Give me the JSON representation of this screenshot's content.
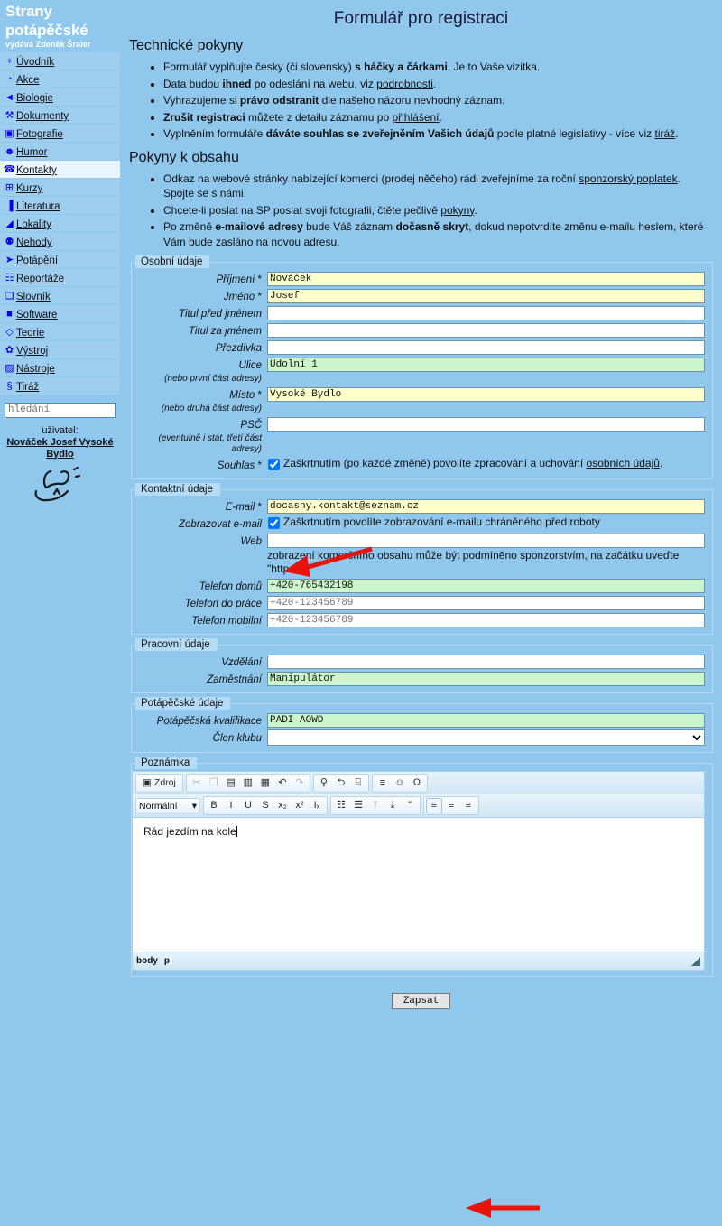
{
  "colors": {
    "page_bg": "#8fc7ed",
    "nav_bg": "#9dcdef",
    "nav_active_bg": "#e9f4fc",
    "legend_bg": "#b5dbf5",
    "required_field_bg": "#ffffcc",
    "filled_field_bg": "#ccf5cc",
    "empty_field_bg": "#ffffff",
    "arrow_red": "#e8130c",
    "title_color": "#1b1b3a"
  },
  "sidebar": {
    "brand_line1": "Strany",
    "brand_line2": "potápěčské",
    "brand_sub": "vydává Zdeněk Šraier",
    "items": [
      {
        "label": "Úvodník",
        "icon": "lightbulb-icon",
        "glyph": "♀",
        "active": false
      },
      {
        "label": "Akce",
        "icon": "clock-icon",
        "glyph": "◔",
        "active": false
      },
      {
        "label": "Biologie",
        "icon": "fish-icon",
        "glyph": "◄",
        "active": false
      },
      {
        "label": "Dokumenty",
        "icon": "stamp-icon",
        "glyph": "⚒",
        "active": false
      },
      {
        "label": "Fotografie",
        "icon": "camera-icon",
        "glyph": "▣",
        "active": false
      },
      {
        "label": "Humor",
        "icon": "clown-icon",
        "glyph": "☻",
        "active": false
      },
      {
        "label": "Kontakty",
        "icon": "contacts-icon",
        "glyph": "☎",
        "active": true
      },
      {
        "label": "Kurzy",
        "icon": "blackboard-icon",
        "glyph": "⊞",
        "active": false
      },
      {
        "label": "Literatura",
        "icon": "books-icon",
        "glyph": "▐",
        "active": false
      },
      {
        "label": "Lokality",
        "icon": "diveflag-icon",
        "glyph": "◢",
        "active": false
      },
      {
        "label": "Nehody",
        "icon": "pin-icon",
        "glyph": "⚉",
        "active": false
      },
      {
        "label": "Potápění",
        "icon": "diver-icon",
        "glyph": "➤",
        "active": false
      },
      {
        "label": "Reportáže",
        "icon": "clipboard-icon",
        "glyph": "☷",
        "active": false
      },
      {
        "label": "Slovník",
        "icon": "dictionary-icon",
        "glyph": "❑",
        "active": false
      },
      {
        "label": "Software",
        "icon": "floppy-icon",
        "glyph": "■",
        "active": false
      },
      {
        "label": "Teorie",
        "icon": "book-icon",
        "glyph": "◇",
        "active": false
      },
      {
        "label": "Výstroj",
        "icon": "gear-icon",
        "glyph": "✿",
        "active": false
      },
      {
        "label": "Nástroje",
        "icon": "tools-icon",
        "glyph": "▨",
        "active": false
      },
      {
        "label": "Tiráž",
        "icon": "section-icon",
        "glyph": "§",
        "active": false
      }
    ],
    "search_placeholder": "hledání",
    "search_value": "",
    "user_caption": "uživatel:",
    "user_name": "Nováček Josef Vysoké Bydlo"
  },
  "main": {
    "page_title": "Formulář pro registraci",
    "technical": {
      "heading": "Technické pokyny",
      "bullets": [
        {
          "parts": [
            {
              "t": "Formulář vyplňujte česky (či slovensky) ",
              "s": "n"
            },
            {
              "t": "s háčky a čárkami",
              "s": "b"
            },
            {
              "t": ". Je to Vaše vizitka.",
              "s": "n"
            }
          ]
        },
        {
          "parts": [
            {
              "t": "Data budou ",
              "s": "n"
            },
            {
              "t": "ihned",
              "s": "b"
            },
            {
              "t": " po odeslání na webu, viz ",
              "s": "n"
            },
            {
              "t": "podrobnosti",
              "s": "a"
            },
            {
              "t": ".",
              "s": "n"
            }
          ]
        },
        {
          "parts": [
            {
              "t": "Vyhrazujeme si ",
              "s": "n"
            },
            {
              "t": "právo odstranit",
              "s": "b"
            },
            {
              "t": " dle našeho názoru nevhodný záznam.",
              "s": "n"
            }
          ]
        },
        {
          "parts": [
            {
              "t": "Zrušit registraci",
              "s": "b"
            },
            {
              "t": " můžete z detailu záznamu po ",
              "s": "n"
            },
            {
              "t": "přihlášení",
              "s": "a"
            },
            {
              "t": ".",
              "s": "n"
            }
          ]
        },
        {
          "parts": [
            {
              "t": "Vyplněním formuláře ",
              "s": "n"
            },
            {
              "t": "dáváte souhlas se zveřejněním Vašich údajů",
              "s": "b"
            },
            {
              "t": " podle platné legislativy - více viz ",
              "s": "n"
            },
            {
              "t": "tiráž",
              "s": "a"
            },
            {
              "t": ".",
              "s": "n"
            }
          ]
        }
      ]
    },
    "content": {
      "heading": "Pokyny k obsahu",
      "bullets": [
        {
          "parts": [
            {
              "t": "Odkaz na webové stránky nabízející komerci (prodej něčeho) rádi zveřejníme za roční ",
              "s": "n"
            },
            {
              "t": "sponzorský poplatek",
              "s": "a"
            },
            {
              "t": ". Spojte se s námi.",
              "s": "n"
            }
          ]
        },
        {
          "parts": [
            {
              "t": "Chcete-li poslat na SP poslat svoji fotografii, čtěte pečlivě ",
              "s": "n"
            },
            {
              "t": "pokyny",
              "s": "a"
            },
            {
              "t": ".",
              "s": "n"
            }
          ]
        },
        {
          "parts": [
            {
              "t": "Po změně ",
              "s": "n"
            },
            {
              "t": "e-mailové adresy",
              "s": "b"
            },
            {
              "t": " bude Váš záznam ",
              "s": "n"
            },
            {
              "t": "dočasně skryt",
              "s": "b"
            },
            {
              "t": ", dokud nepotvrdíte změnu e-mailu heslem, které Vám bude zasláno na novou adresu.",
              "s": "n"
            }
          ]
        }
      ]
    },
    "fieldsets": {
      "personal": {
        "legend": "Osobní údaje",
        "fields": [
          {
            "label": "Příjmení",
            "required": true,
            "value": "Nováček",
            "state": "req"
          },
          {
            "label": "Jméno",
            "required": true,
            "value": "Josef",
            "state": "req"
          },
          {
            "label": "Titul před jménem",
            "required": false,
            "value": "",
            "state": "empty"
          },
          {
            "label": "Titul za jménem",
            "required": false,
            "value": "",
            "state": "empty"
          },
          {
            "label": "Přezdívka",
            "required": false,
            "value": "",
            "state": "empty"
          },
          {
            "label": "Ulice",
            "sub": "(nebo první část adresy)",
            "required": false,
            "value": "Údolní 1",
            "state": "filled"
          },
          {
            "label": "Místo",
            "sub": "(nebo druhá část adresy)",
            "required": true,
            "value": "Vysoké Bydlo",
            "state": "req"
          },
          {
            "label": "PSČ",
            "sub": "(eventulně i stát, třetí část adresy)",
            "required": false,
            "value": "",
            "state": "empty"
          }
        ],
        "consent": {
          "label": "Souhlas",
          "required": true,
          "checked": true,
          "text_before": "Zaškrtnutím (po každé změně) povolíte zpracování a uchování ",
          "link": "osobních údajů",
          "text_after": "."
        }
      },
      "contact": {
        "legend": "Kontaktní údaje",
        "email": {
          "label": "E-mail",
          "required": true,
          "value": "docasny.kontakt@seznam.cz",
          "state": "req"
        },
        "show_email": {
          "label": "Zobrazovat e-mail",
          "checked": true,
          "text": "Zaškrtnutím povolíte zobrazování e-mailu chráněného před roboty"
        },
        "web": {
          "label": "Web",
          "value": "",
          "state": "empty"
        },
        "web_hint": "zobrazení komerčního obsahu může být podmíněno sponzorstvím, na začátku uveďte \"http://\"",
        "phones": [
          {
            "label": "Telefon domů",
            "value": "+420-765432198",
            "state": "filled",
            "placeholder": false
          },
          {
            "label": "Telefon do práce",
            "value": "+420-123456789",
            "state": "empty",
            "placeholder": true
          },
          {
            "label": "Telefon mobilní",
            "value": "+420-123456789",
            "state": "empty",
            "placeholder": true
          }
        ]
      },
      "work": {
        "legend": "Pracovní údaje",
        "fields": [
          {
            "label": "Vzdělání",
            "value": "",
            "state": "empty"
          },
          {
            "label": "Zaměstnání",
            "value": "Manipulátor",
            "state": "filled"
          }
        ]
      },
      "diving": {
        "legend": "Potápěčské údaje",
        "qualification": {
          "label": "Potápěčská kvalifikace",
          "value": "PADI AOWD",
          "state": "filled"
        },
        "club": {
          "label": "Člen klubu",
          "selected": "",
          "options": [
            ""
          ]
        }
      },
      "note": {
        "legend": "Poznámka",
        "editor": {
          "source_button": "Zdroj",
          "format_selected": "Normální",
          "toolbar_row1": [
            {
              "name": "source-button",
              "glyph": "▣",
              "label": "Zdroj",
              "state": "normal",
              "group": 1
            },
            {
              "name": "cut-icon",
              "glyph": "✂",
              "state": "dim",
              "group": 2
            },
            {
              "name": "copy-icon",
              "glyph": "❐",
              "state": "dim",
              "group": 2
            },
            {
              "name": "paste-icon",
              "glyph": "▤",
              "state": "normal",
              "group": 2
            },
            {
              "name": "paste-text-icon",
              "glyph": "▥",
              "state": "normal",
              "group": 2
            },
            {
              "name": "paste-word-icon",
              "glyph": "▦",
              "state": "normal",
              "group": 2
            },
            {
              "name": "undo-icon",
              "glyph": "↶",
              "state": "normal",
              "group": 2
            },
            {
              "name": "redo-icon",
              "glyph": "↷",
              "state": "dim",
              "group": 2
            },
            {
              "name": "find-icon",
              "glyph": "⚲",
              "state": "normal",
              "group": 3
            },
            {
              "name": "replace-icon",
              "glyph": "⮌",
              "state": "normal",
              "group": 3
            },
            {
              "name": "select-all-icon",
              "glyph": "⌸",
              "state": "normal",
              "group": 3
            },
            {
              "name": "horizontal-rule-icon",
              "glyph": "≡",
              "state": "normal",
              "group": 4
            },
            {
              "name": "smiley-icon",
              "glyph": "☺",
              "state": "normal",
              "group": 4
            },
            {
              "name": "special-char-icon",
              "glyph": "Ω",
              "state": "normal",
              "group": 4
            }
          ],
          "toolbar_row2": [
            {
              "name": "bold-icon",
              "glyph": "B",
              "state": "normal",
              "group": 2
            },
            {
              "name": "italic-icon",
              "glyph": "I",
              "state": "normal",
              "group": 2
            },
            {
              "name": "underline-icon",
              "glyph": "U",
              "state": "normal",
              "group": 2
            },
            {
              "name": "strikethrough-icon",
              "glyph": "S",
              "state": "normal",
              "group": 2
            },
            {
              "name": "subscript-icon",
              "glyph": "x₂",
              "state": "normal",
              "group": 2
            },
            {
              "name": "superscript-icon",
              "glyph": "x²",
              "state": "normal",
              "group": 2
            },
            {
              "name": "remove-format-icon",
              "glyph": "Iₓ",
              "state": "normal",
              "group": 2
            },
            {
              "name": "numbered-list-icon",
              "glyph": "☷",
              "state": "normal",
              "group": 3
            },
            {
              "name": "bulleted-list-icon",
              "glyph": "☰",
              "state": "normal",
              "group": 3
            },
            {
              "name": "outdent-icon",
              "glyph": "⤒",
              "state": "dim",
              "group": 3
            },
            {
              "name": "indent-icon",
              "glyph": "⤓",
              "state": "normal",
              "group": 3
            },
            {
              "name": "blockquote-icon",
              "glyph": "”",
              "state": "normal",
              "group": 3
            },
            {
              "name": "align-left-icon",
              "glyph": "≡",
              "state": "on",
              "group": 4
            },
            {
              "name": "align-center-icon",
              "glyph": "≡",
              "state": "normal",
              "group": 4
            },
            {
              "name": "align-right-icon",
              "glyph": "≡",
              "state": "normal",
              "group": 4
            }
          ],
          "content": "Rád jezdím na kole",
          "element_path": [
            "body",
            "p"
          ]
        }
      }
    },
    "submit_label": "Zapsat"
  }
}
